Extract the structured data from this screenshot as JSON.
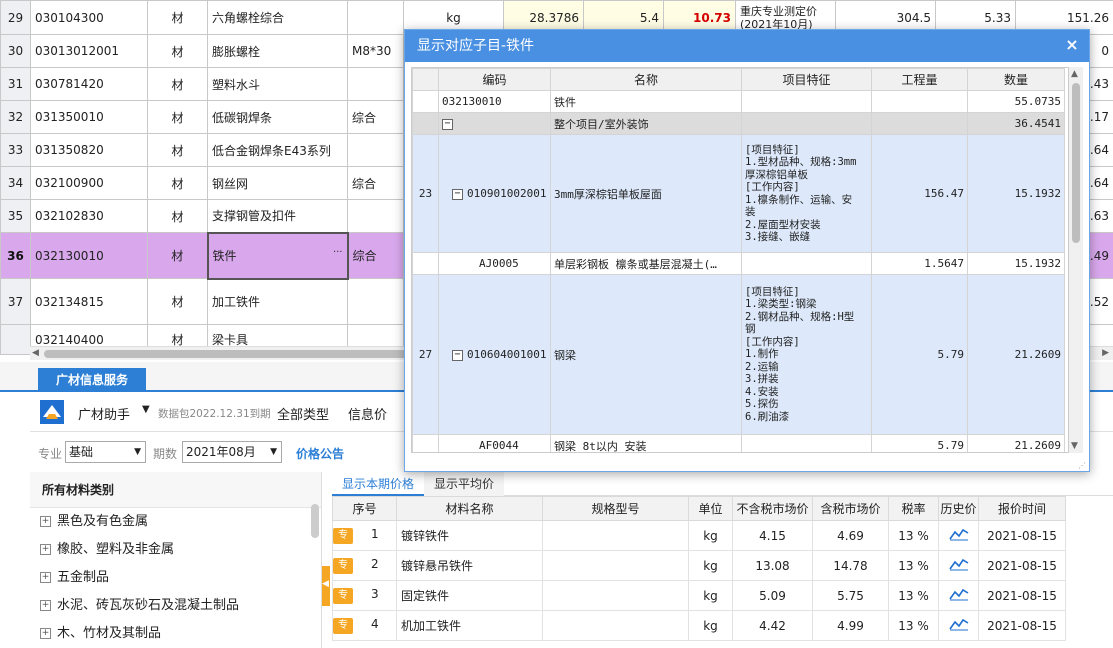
{
  "top_grid": {
    "rows": [
      {
        "no": "29",
        "code": "030104300",
        "type": "材",
        "name": "六角螺栓综合",
        "spec": "",
        "unit": "kg",
        "v1": "28.3786",
        "v2": "5.4",
        "v3": "10.73",
        "src": "重庆专业测定价(2021年10月)",
        "v4": "304.5",
        "v5": "5.33",
        "v6": "151.26"
      },
      {
        "no": "30",
        "code": "03013012001",
        "type": "材",
        "name": "膨胀螺栓",
        "spec": "M8*30",
        "unit": "",
        "v1": "",
        "v2": "",
        "v3": "",
        "src": "",
        "v4": "",
        "v5": "",
        "v6": "0"
      },
      {
        "no": "31",
        "code": "030781420",
        "type": "材",
        "name": "塑料水斗",
        "spec": "",
        "unit": "",
        "v1": "",
        "v2": "",
        "v3": "",
        "src": "",
        "v4": "",
        "v5": "",
        "v6": ".43"
      },
      {
        "no": "32",
        "code": "031350010",
        "type": "材",
        "name": "低碳钢焊条",
        "spec": "综合",
        "unit": "",
        "v1": "",
        "v2": "",
        "v3": "",
        "src": "",
        "v4": "",
        "v5": "",
        "v6": ".17"
      },
      {
        "no": "33",
        "code": "031350820",
        "type": "材",
        "name": "低合金钢焊条E43系列",
        "spec": "",
        "unit": "",
        "v1": "",
        "v2": "",
        "v3": "",
        "src": "",
        "v4": "",
        "v5": "",
        "v6": ".64"
      },
      {
        "no": "34",
        "code": "032100900",
        "type": "材",
        "name": "钢丝网",
        "spec": "综合",
        "unit": "",
        "v1": "",
        "v2": "",
        "v3": "",
        "src": "",
        "v4": "",
        "v5": "",
        "v6": ".64"
      },
      {
        "no": "35",
        "code": "032102830",
        "type": "材",
        "name": "支撑钢管及扣件",
        "spec": "",
        "unit": "",
        "v1": "",
        "v2": "",
        "v3": "",
        "src": "",
        "v4": "",
        "v5": "",
        "v6": ".63"
      },
      {
        "no": "36",
        "code": "032130010",
        "type": "材",
        "name": "铁件",
        "spec": "综合",
        "unit": "",
        "v1": "",
        "v2": "",
        "v3": "",
        "src": "",
        "v4": "",
        "v5": "",
        "v6": ".49"
      },
      {
        "no": "37",
        "code": "032134815",
        "type": "材",
        "name": "加工铁件",
        "spec": "",
        "unit": "",
        "v1": "",
        "v2": "",
        "v3": "",
        "src": "",
        "v4": "",
        "v5": "",
        "v6": ".52"
      }
    ],
    "cell_more": "···",
    "partial_row_code": "032140400",
    "partial_row_type": "材",
    "partial_row_name": "梁卡具"
  },
  "bottom": {
    "tab_label": "广材信息服务",
    "assistant_label": "广材助手",
    "data_package": "数据包2022.12.31到期",
    "all_types": "全部类型",
    "info_price": "信息价",
    "filter": {
      "major_label": "专业",
      "major_value": "基础",
      "period_label": "期数",
      "period_value": "2021年08月",
      "announce_label": "价格公告"
    },
    "category_header": "所有材料类别",
    "categories": [
      "黑色及有色金属",
      "橡胶、塑料及非金属",
      "五金制品",
      "水泥、砖瓦灰砂石及混凝土制品",
      "木、竹材及其制品"
    ],
    "price_tabs": [
      "显示本期价格",
      "显示平均价"
    ],
    "price_headers": [
      "序号",
      "材料名称",
      "规格型号",
      "单位",
      "不含税市场价",
      "含税市场价",
      "税率",
      "历史价",
      "报价时间"
    ],
    "price_badge": "专",
    "price_rows": [
      {
        "no": "1",
        "name": "镀锌铁件",
        "spec": "",
        "unit": "kg",
        "ex": "4.15",
        "inc": "4.69",
        "tax": "13 %",
        "date": "2021-08-15"
      },
      {
        "no": "2",
        "name": "镀锌悬吊铁件",
        "spec": "",
        "unit": "kg",
        "ex": "13.08",
        "inc": "14.78",
        "tax": "13 %",
        "date": "2021-08-15"
      },
      {
        "no": "3",
        "name": "固定铁件",
        "spec": "",
        "unit": "kg",
        "ex": "5.09",
        "inc": "5.75",
        "tax": "13 %",
        "date": "2021-08-15"
      },
      {
        "no": "4",
        "name": "机加工铁件",
        "spec": "",
        "unit": "kg",
        "ex": "4.42",
        "inc": "4.99",
        "tax": "13 %",
        "date": "2021-08-15"
      }
    ]
  },
  "dialog": {
    "title": "显示对应子目-铁件",
    "close": "×",
    "headers": [
      "编码",
      "名称",
      "项目特征",
      "工程量",
      "数量"
    ],
    "rows": [
      {
        "no": "",
        "code": "032130010",
        "name": "铁件",
        "feat": "",
        "qty": "",
        "amount": "55.0735"
      },
      {
        "no": "",
        "code": "",
        "name": "整个项目/室外装饰",
        "feat": "",
        "qty": "",
        "amount": "36.4541"
      },
      {
        "no": "23",
        "code": "010901002001",
        "name": "3mm厚深棕铝单板屋面",
        "feat": "[项目特征]\n1.型材品种、规格:3mm\n厚深棕铝单板\n[工作内容]\n1.檩条制作、运输、安\n装\n2.屋面型材安装\n3.接缝、嵌缝",
        "qty": "156.47",
        "amount": "15.1932"
      },
      {
        "no": "",
        "code": "AJ0005",
        "name": "单层彩钢板 檩条或基层混凝土(…",
        "feat": "",
        "qty": "1.5647",
        "amount": "15.1932"
      },
      {
        "no": "27",
        "code": "010604001001",
        "name": "钢梁",
        "feat": "[项目特征]\n1.梁类型:钢梁\n2.钢材品种、规格:H型\n钢\n[工作内容]\n1.制作\n2.运输\n3.拼装\n4.安装\n5.探伤\n6.刷油漆",
        "qty": "5.79",
        "amount": "21.2609"
      },
      {
        "no": "",
        "code": "AF0044",
        "name": "钢梁 8t以内 安装",
        "feat": "",
        "qty": "5.79",
        "amount": "21.2609"
      }
    ]
  }
}
